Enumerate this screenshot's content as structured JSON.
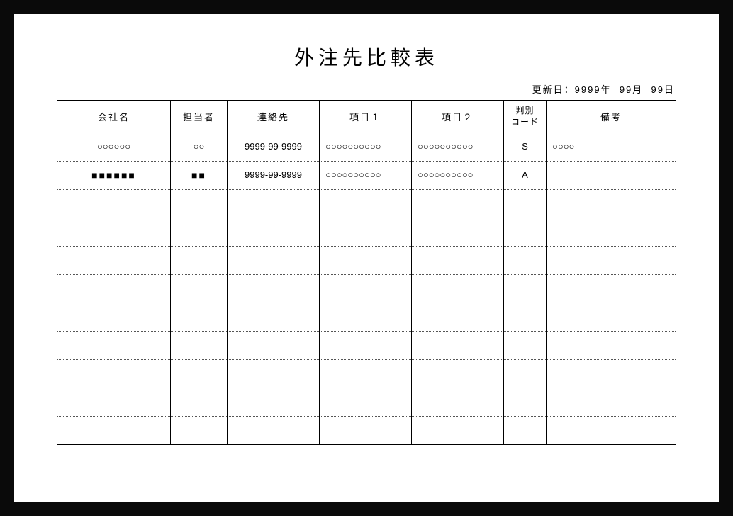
{
  "title": "外注先比較表",
  "update_label": "更新日：",
  "update_year": "9999年",
  "update_month": "99月",
  "update_day": "99日",
  "headers": {
    "company": "会社名",
    "person": "担当者",
    "contact": "連絡先",
    "item1": "項目１",
    "item2": "項目２",
    "code": "判別\nコード",
    "note": "備考"
  },
  "rows": [
    {
      "company": "○○○○○○",
      "person": "○○",
      "contact": "9999-99-9999",
      "item1": "○○○○○○○○○○",
      "item2": "○○○○○○○○○○",
      "code": "S",
      "note": "○○○○"
    },
    {
      "company": "■■■■■■",
      "person": "■■",
      "contact": "9999-99-9999",
      "item1": "○○○○○○○○○○",
      "item2": "○○○○○○○○○○",
      "code": "A",
      "note": ""
    },
    {
      "company": "",
      "person": "",
      "contact": "",
      "item1": "",
      "item2": "",
      "code": "",
      "note": ""
    },
    {
      "company": "",
      "person": "",
      "contact": "",
      "item1": "",
      "item2": "",
      "code": "",
      "note": ""
    },
    {
      "company": "",
      "person": "",
      "contact": "",
      "item1": "",
      "item2": "",
      "code": "",
      "note": ""
    },
    {
      "company": "",
      "person": "",
      "contact": "",
      "item1": "",
      "item2": "",
      "code": "",
      "note": ""
    },
    {
      "company": "",
      "person": "",
      "contact": "",
      "item1": "",
      "item2": "",
      "code": "",
      "note": ""
    },
    {
      "company": "",
      "person": "",
      "contact": "",
      "item1": "",
      "item2": "",
      "code": "",
      "note": ""
    },
    {
      "company": "",
      "person": "",
      "contact": "",
      "item1": "",
      "item2": "",
      "code": "",
      "note": ""
    },
    {
      "company": "",
      "person": "",
      "contact": "",
      "item1": "",
      "item2": "",
      "code": "",
      "note": ""
    },
    {
      "company": "",
      "person": "",
      "contact": "",
      "item1": "",
      "item2": "",
      "code": "",
      "note": ""
    }
  ]
}
